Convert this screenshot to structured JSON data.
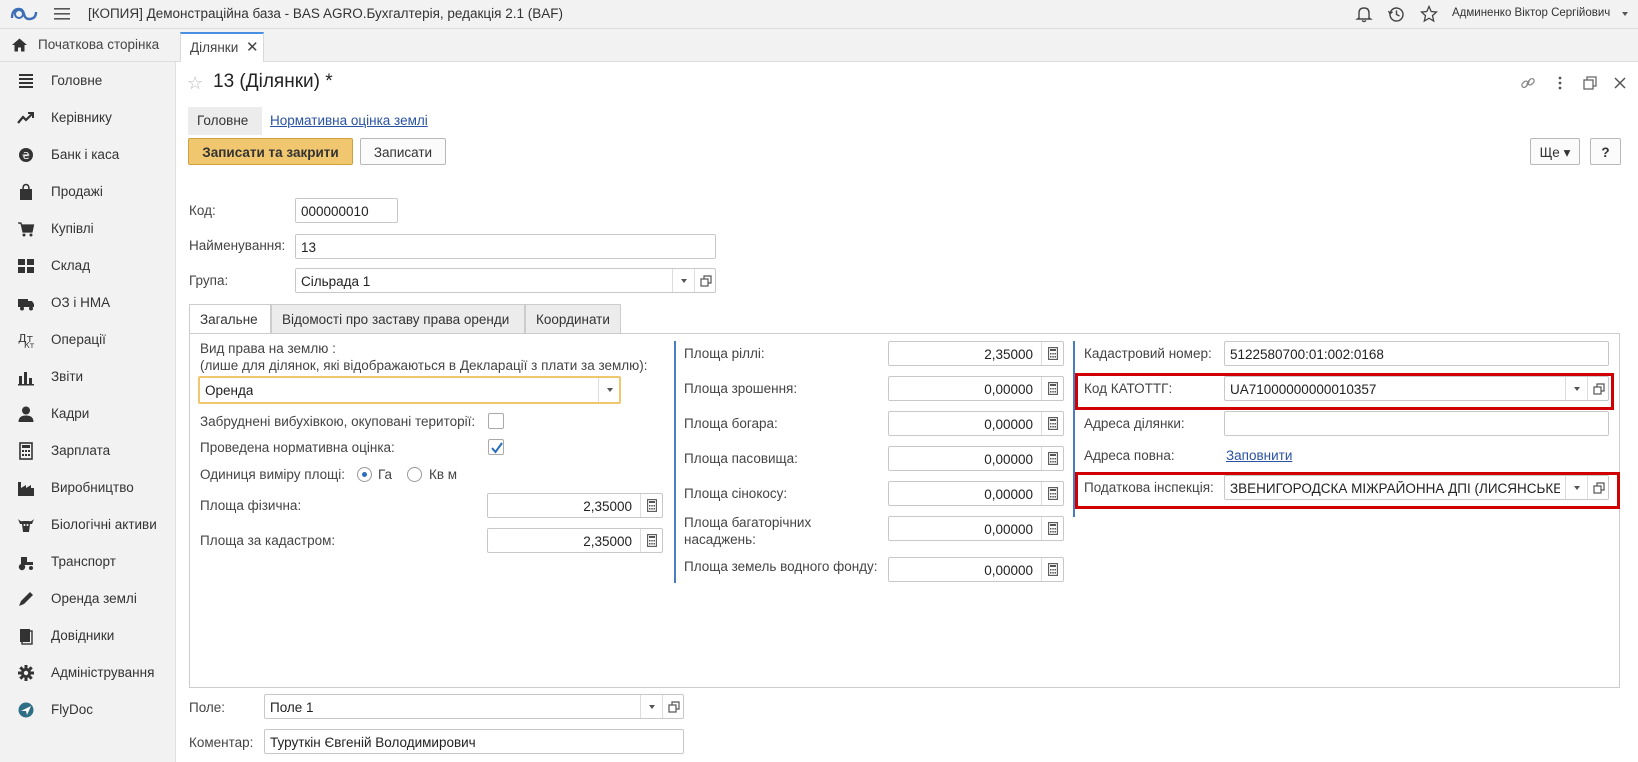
{
  "window": {
    "title": "[КОПИЯ] Демонстраційна база - BAS AGRO.Бухгалтерія, редакція 2.1  (BAF)",
    "user": "Админенко Віктор Сергійович"
  },
  "tabs": {
    "home": "Початкова сторінка",
    "open": "Ділянки"
  },
  "sidebar": {
    "items": [
      {
        "label": "Головне",
        "icon": "menu-lines-icon"
      },
      {
        "label": "Керівнику",
        "icon": "trend-icon"
      },
      {
        "label": "Банк і каса",
        "icon": "coin-icon"
      },
      {
        "label": "Продажі",
        "icon": "bag-icon"
      },
      {
        "label": "Купівлі",
        "icon": "cart-icon"
      },
      {
        "label": "Склад",
        "icon": "warehouse-icon"
      },
      {
        "label": "ОЗ і НМА",
        "icon": "truck-icon"
      },
      {
        "label": "Операції",
        "icon": "operations-icon"
      },
      {
        "label": "Звіти",
        "icon": "bars-icon"
      },
      {
        "label": "Кадри",
        "icon": "person-icon"
      },
      {
        "label": "Зарплата",
        "icon": "calculator-icon"
      },
      {
        "label": "Виробництво",
        "icon": "factory-icon"
      },
      {
        "label": "Біологічні активи",
        "icon": "cow-icon"
      },
      {
        "label": "Транспорт",
        "icon": "tractor-icon"
      },
      {
        "label": "Оренда землі",
        "icon": "pen-icon"
      },
      {
        "label": "Довідники",
        "icon": "books-icon"
      },
      {
        "label": "Адміністрування",
        "icon": "gear-icon"
      },
      {
        "label": "FlyDoc",
        "icon": "flydoc-icon"
      }
    ]
  },
  "form": {
    "title": "13 (Ділянки) *",
    "tab_main": "Головне",
    "tab_norm": "Нормативна оцінка землі",
    "btn_save_close": "Записати та закрити",
    "btn_save": "Записати",
    "btn_more": "Ще",
    "btn_help": "?",
    "code_label": "Код:",
    "code_value": "000000010",
    "name_label": "Найменування:",
    "name_value": "13",
    "group_label": "Група:",
    "group_value": "Сільрада 1",
    "inner_tabs": [
      "Загальне",
      "Відомості про заставу права оренди",
      "Координати"
    ],
    "right_type_label_1": "Вид права на землю :",
    "right_type_label_2": "(лише для ділянок, які відображаються в Декларації з плати за землю):",
    "right_type_value": "Оренда",
    "polluted_label": "Забруднені вибухівкою, окуповані території:",
    "norm_done_label": "Проведена нормативна оцінка:",
    "unit_label": "Одиниця виміру площі:",
    "unit_ha": "Га",
    "unit_sqm": "Кв м",
    "area_phys_label": "Площа фізична:",
    "area_phys_value": "2,35000",
    "area_cad_label": "Площа за кадастром:",
    "area_cad_value": "2,35000",
    "arable_label": "Площа ріллі:",
    "arable_value": "2,35000",
    "irrigation_label": "Площа зрошення:",
    "irrigation_value": "0,00000",
    "bogara_label": "Площа богара:",
    "bogara_value": "0,00000",
    "pasture_label": "Площа пасовища:",
    "pasture_value": "0,00000",
    "hayfield_label": "Площа сінокосу:",
    "hayfield_value": "0,00000",
    "perennial_label_1": "Площа багаторічних",
    "perennial_label_2": "насаджень:",
    "perennial_value": "0,00000",
    "water_label": "Площа земель водного фонду:",
    "water_value": "0,00000",
    "cadastral_label": "Кадастровий номер:",
    "cadastral_value": "5122580700:01:002:0168",
    "katottg_label": "Код КАТОТТГ:",
    "katottg_value": "UA71000000000010357",
    "address_label": "Адреса ділянки:",
    "address_value": "",
    "full_address_label": "Адреса повна:",
    "full_address_link": "Заповнити",
    "tax_label": "Податкова інспекція:",
    "tax_value": "ЗВЕНИГОРОДСКА МІЖРАЙОННА ДПІ (ЛИСЯНСЬКЕ",
    "field_label": "Поле:",
    "field_value": "Поле 1",
    "comment_label": "Коментар:",
    "comment_value": "Туруткін Євгеній Володимирович"
  },
  "checks": {
    "polluted": false,
    "norm_done": true,
    "unit_selected": "Га"
  },
  "colors": {
    "primary_button": "#f0c66e",
    "highlight": "#d00000",
    "link": "#2952a3",
    "accent_line": "#4a7cc0"
  }
}
